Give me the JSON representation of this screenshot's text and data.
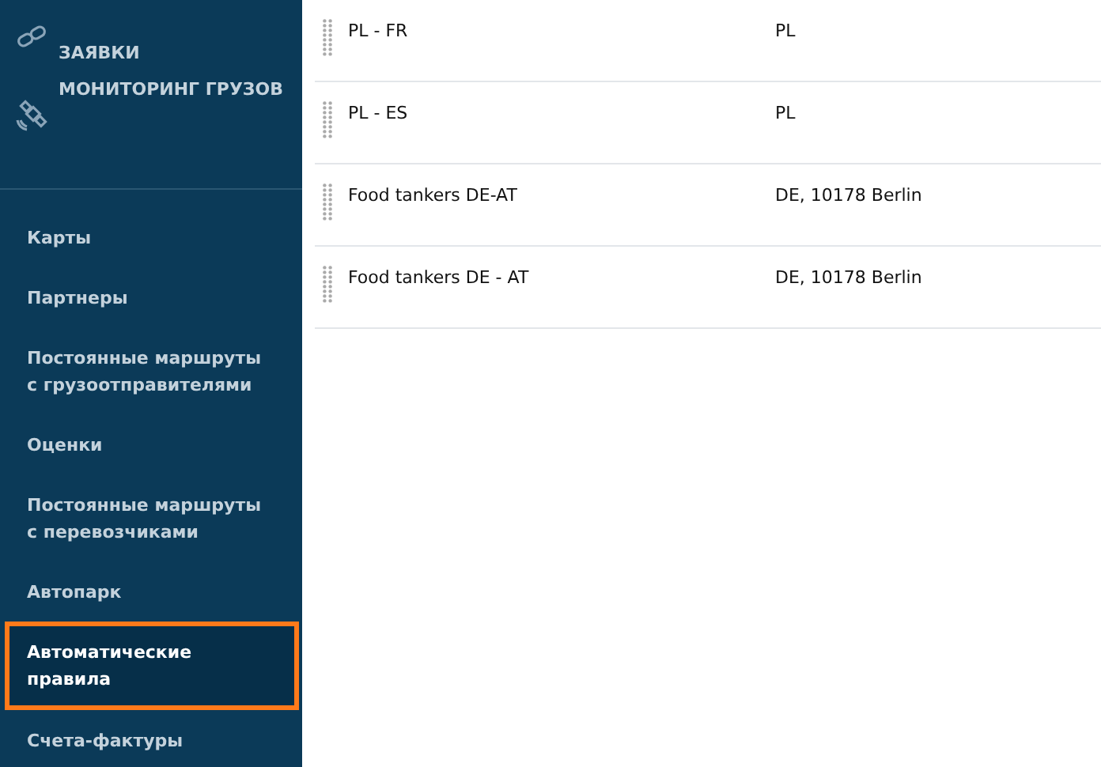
{
  "sidebar": {
    "top_items": [
      {
        "label": "ЗАЯВКИ",
        "kind": "link"
      },
      {
        "label": "МОНИТОРИНГ ГРУЗОВ",
        "kind": "satellite"
      }
    ],
    "items": [
      {
        "label": "Карты",
        "selected": false
      },
      {
        "label": "Партнеры",
        "selected": false
      },
      {
        "label": "Постоянные маршруты с грузоотправителями",
        "selected": false
      },
      {
        "label": "Оценки",
        "selected": false
      },
      {
        "label": "Постоянные маршруты с перевозчиками",
        "selected": false
      },
      {
        "label": "Автопарк",
        "selected": false
      },
      {
        "label": "Автоматические правила",
        "selected": true
      },
      {
        "label": "Счета-фактуры",
        "selected": false
      }
    ]
  },
  "table": {
    "rows": [
      {
        "name": "PL - FR",
        "location": "PL"
      },
      {
        "name": "PL - ES",
        "location": "PL"
      },
      {
        "name": "Food tankers DE-AT",
        "location": "DE, 10178 Berlin"
      },
      {
        "name": "Food tankers DE - AT",
        "location": "DE, 10178 Berlin"
      }
    ]
  }
}
